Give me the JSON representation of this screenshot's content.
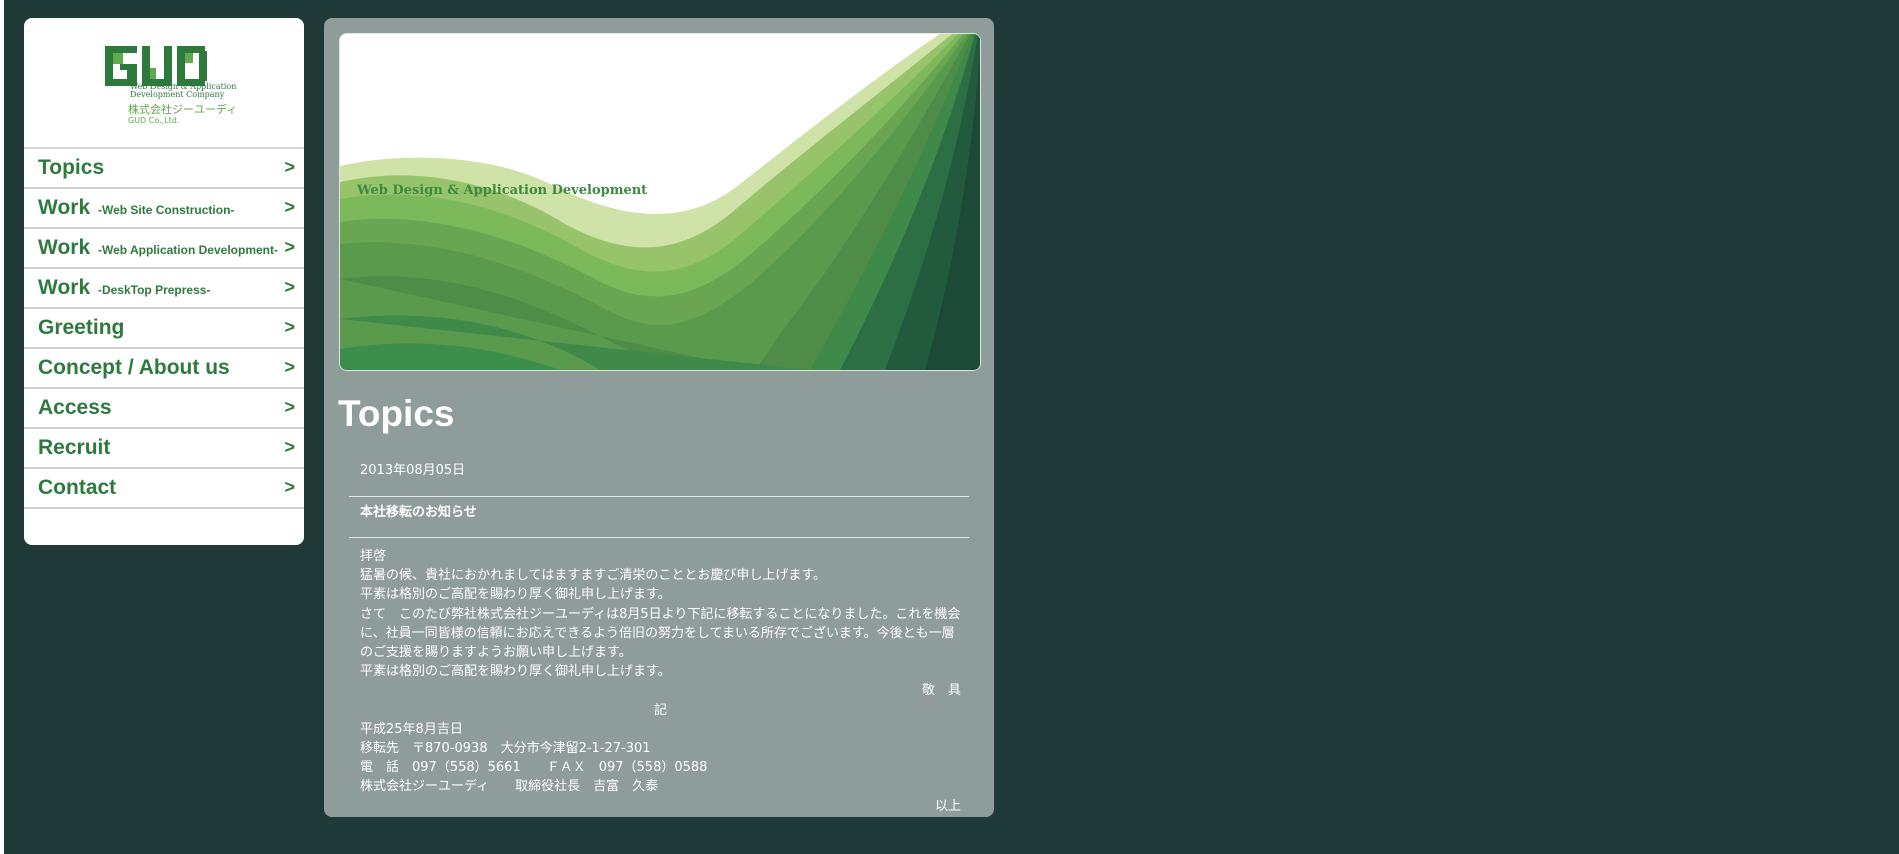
{
  "brand": {
    "logo_text": "GUD",
    "tagline": [
      "Web Design & Application",
      "Development Company"
    ],
    "company_jp": "株式会社ジーユーディ",
    "company_en": "GUD Co.,Ltd.",
    "color": "#2e7a3e"
  },
  "nav": [
    {
      "label": "Topics",
      "sub": "",
      "arrow": ">"
    },
    {
      "label": "Work",
      "sub": "-Web Site Construction-",
      "arrow": ">"
    },
    {
      "label": "Work",
      "sub": "-Web Application Development-",
      "arrow": ">"
    },
    {
      "label": "Work",
      "sub": "-DeskTop Prepress-",
      "arrow": ">"
    },
    {
      "label": "Greeting",
      "sub": "",
      "arrow": ">"
    },
    {
      "label": "Concept / About us",
      "sub": "",
      "arrow": ">"
    },
    {
      "label": "Access",
      "sub": "",
      "arrow": ">"
    },
    {
      "label": "Recruit",
      "sub": "",
      "arrow": ">"
    },
    {
      "label": "Contact",
      "sub": "",
      "arrow": ">"
    }
  ],
  "hero": {
    "caption": "Web Design & Application Development"
  },
  "main": {
    "title": "Topics",
    "post": {
      "date": "2013年08月05日",
      "title": "本社移転のお知らせ",
      "body": {
        "opening": "拝啓",
        "p1": "猛暑の候、貴社におかれましてはますますご清栄のこととお慶び申し上げます。",
        "p2": "平素は格別のご高配を賜わり厚く御礼申し上げます。",
        "p3": "さて　このたび弊社株式会社ジーユーディは8月5日より下記に移転することになりました。これを機会に、社員一同皆様の信頼にお応えできるよう倍旧の努力をしてまいる所存でございます。今後とも一層のご支援を賜りますようお願い申し上げます。",
        "p4": "平素は格別のご高配を賜わり厚く御礼申し上げます。",
        "closing": "敬　具",
        "ki": "記",
        "date_line": "平成25年8月吉日",
        "address": "移転先　〒870-0938　大分市今津留2-1-27-301",
        "phone": "電　話　097（558）5661　　ＦＡＸ　097（558）0588",
        "signature": "株式会社ジーユーディ　　取締役社長　吉富　久泰",
        "end": "以上"
      }
    }
  },
  "colors": {
    "background": "#1f3937",
    "panel": "#8f9d9a",
    "nav_text": "#2e7a3e"
  }
}
